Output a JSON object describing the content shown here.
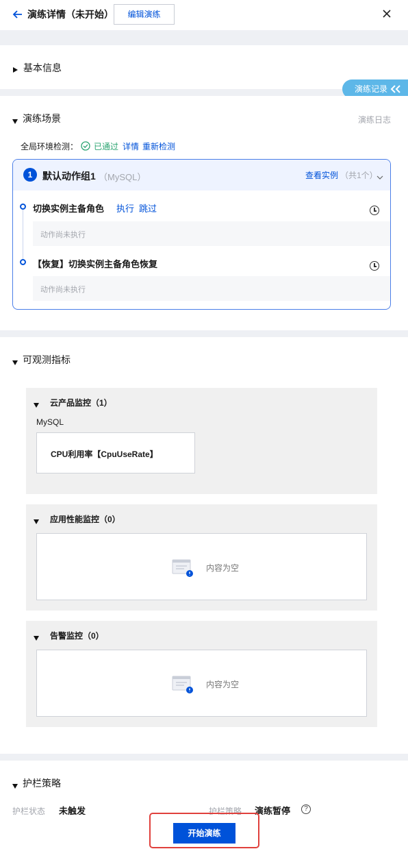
{
  "header": {
    "title": "演练详情（未开始）",
    "edit_button": "编辑演练"
  },
  "basic_info": {
    "title": "基本信息"
  },
  "log_tab": {
    "label": "演练记录"
  },
  "scene": {
    "title": "演练场景",
    "log_link": "演练日志",
    "env_check_label": "全局环境检测：",
    "env_check_status": "已通过",
    "env_check_detail": "详情",
    "env_check_retry": "重新检测",
    "group": {
      "index": "1",
      "name": "默认动作组1",
      "type": "（MySQL）",
      "view_instances": "查看实例",
      "instance_count": "（共1个）",
      "steps": [
        {
          "name": "切换实例主备角色",
          "action_execute": "执行",
          "action_skip": "跳过",
          "status": "动作尚未执行"
        },
        {
          "name": "【恢复】切换实例主备角色恢复",
          "status": "动作尚未执行"
        }
      ]
    }
  },
  "metrics": {
    "title": "可观测指标",
    "cloud": {
      "title": "云产品监控（1）",
      "product": "MySQL",
      "metric": "CPU利用率【CpuUseRate】"
    },
    "apm": {
      "title": "应用性能监控（0）",
      "empty": "内容为空"
    },
    "alarm": {
      "title": "告警监控（0）",
      "empty": "内容为空"
    }
  },
  "guardrail": {
    "title": "护栏策略",
    "status_label": "护栏状态",
    "status_value": "未触发",
    "policy_label": "护栏策略",
    "policy_value": "演练暂停"
  },
  "footer": {
    "start_button": "开始演练"
  },
  "colors": {
    "primary": "#0052d9",
    "success": "#2ba471",
    "highlight": "#e0403c"
  }
}
